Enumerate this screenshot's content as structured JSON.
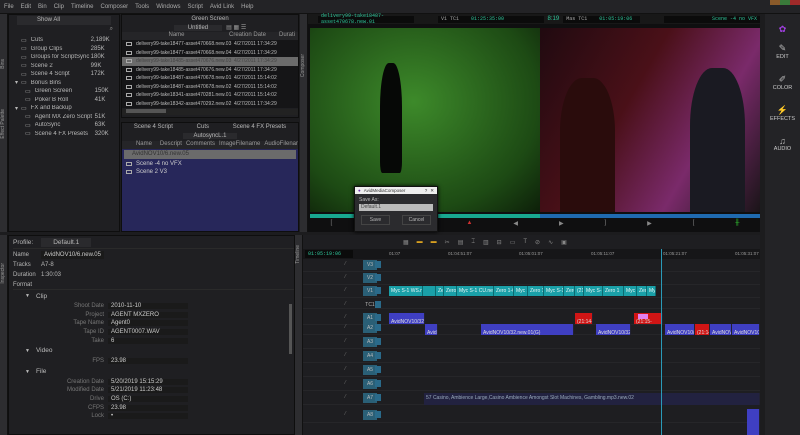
{
  "menu": [
    "File",
    "Edit",
    "Bin",
    "Clip",
    "Timeline",
    "Composer",
    "Tools",
    "Windows",
    "Script",
    "Avid Link",
    "Help"
  ],
  "bins_panel": {
    "show": "Show All",
    "tab_bins": "Bins",
    "tab_effects": "Effect Palette",
    "items": [
      {
        "name": "Cuts",
        "size": "2,189K"
      },
      {
        "name": "Group Clips",
        "size": "285K"
      },
      {
        "name": "Groups for ScriptSync",
        "size": "180K"
      },
      {
        "name": "Scene 2",
        "size": "99K"
      },
      {
        "name": "Scene 4 Script",
        "size": "172K"
      },
      {
        "name": "Bonus Bins",
        "size": ""
      },
      {
        "name": "Green Screen",
        "size": "150K"
      },
      {
        "name": "Poker B Roll",
        "size": "41K"
      },
      {
        "name": "FX and Backup",
        "size": ""
      },
      {
        "name": "Agent MX Zero Script",
        "size": "51K"
      },
      {
        "name": "AutoSync",
        "size": "63K"
      },
      {
        "name": "Scene 4 FX Presets",
        "size": "320K"
      }
    ]
  },
  "green_bin": {
    "title": "Green Screen",
    "view": "Untitled",
    "cols": [
      "Name",
      "Creation Date",
      "Durati"
    ],
    "rows": [
      [
        "delivery99-take18477-asset470668.new.03",
        "4/27/2011 17:34:29"
      ],
      [
        "delivery99-take18477-asset470668.new.04",
        "4/27/2011 17:34:29"
      ],
      [
        "delivery99-take18485-asset470676.new.03",
        "4/27/2011 17:34:29"
      ],
      [
        "delivery99-take18485-asset470676.new.04",
        "4/27/2011 17:34:29"
      ],
      [
        "delivery99-take18487-asset470678.new.01",
        "4/27/2011 15:14:02"
      ],
      [
        "delivery99-take18487-asset470678.new.02",
        "4/27/2011 15:14:02"
      ],
      [
        "delivery99-take18341-asset470281.new.01",
        "4/27/2011 15:14:02"
      ],
      [
        "delivery99-take18342-asset470292.new.02",
        "4/27/2011 17:34:29"
      ]
    ]
  },
  "script_bin": {
    "tabs": [
      "Scene 4 Script",
      "Cuts",
      "Scene 4 FX Presets"
    ],
    "view": "AutosyncL.1",
    "cols": [
      "Name",
      "Descript",
      "Comments",
      "ImageFilename",
      "AudioFilenar"
    ],
    "rows": [
      "AvidNOV10/6.new.05",
      "Scene -4 no VFX",
      "Scene 2 V3"
    ]
  },
  "composer": {
    "tab": "Composer",
    "source_clip": "delivery99-take18487-asset470678.new.01",
    "v1_label": "V1  TC1",
    "v1_tc": "01:25:35:00",
    "dur": "8:19",
    "mas_label": "Mas  TC1",
    "mas_tc": "01:05:19:06",
    "record_seq": "Scene -4 no VFX"
  },
  "right_bar": [
    {
      "label": "EDIT",
      "icon": "edit-icon"
    },
    {
      "label": "COLOR",
      "icon": "color-icon"
    },
    {
      "label": "EFFECTS",
      "icon": "effects-icon"
    },
    {
      "label": "AUDIO",
      "icon": "audio-icon"
    }
  ],
  "dialog": {
    "title": "AvidMediaComposer",
    "help": "?",
    "close": "✕",
    "label": "Save As:",
    "value": "Default.1",
    "save": "Save",
    "cancel": "Cancel"
  },
  "inspector": {
    "tab": "Inspector",
    "profile_label": "Profile:",
    "profile": "Default.1",
    "name_label": "Name",
    "name": "AvidNOV10/6.new.05",
    "tracks_label": "Tracks",
    "tracks": "A7-8",
    "duration_label": "Duration",
    "duration": "1:30:03",
    "format_label": "Format",
    "clip": {
      "title": "Clip",
      "fields": [
        [
          "Shoot Date",
          "2010-11-10"
        ],
        [
          "Project",
          "AGENT MXZERO"
        ],
        [
          "Tape Name",
          "Agent0"
        ],
        [
          "Tape ID",
          "AGENT0007.WAV"
        ],
        [
          "Take",
          "6"
        ]
      ]
    },
    "video": {
      "title": "Video",
      "fields": [
        [
          "FPS",
          "23.98"
        ]
      ]
    },
    "file": {
      "title": "File",
      "fields": [
        [
          "Creation Date",
          "5/20/2019 15:15:29"
        ],
        [
          "Modified Date",
          "5/21/2019 11:23:48"
        ],
        [
          "Drive",
          "OS (C:)"
        ],
        [
          "CFPS",
          "23.98"
        ],
        [
          "Lock",
          "•"
        ]
      ]
    }
  },
  "timeline": {
    "tab": "Timeline",
    "tc": "01:05:19:06",
    "ruler": [
      "01:07",
      "01:04:51:07",
      "01:05:01:07",
      "01:05:11:07",
      "01:05:21:07",
      "01:05:31:07"
    ],
    "tracks": [
      "V3",
      "V2",
      "V1",
      "TC1",
      "A1",
      "A2",
      "A3",
      "A4",
      "A5",
      "A6",
      "A7",
      "A8"
    ],
    "v1_clips": [
      "Myc S-1 WS.new",
      "",
      "Zero 1",
      "Zero 1",
      "Myc S-1 CU.new.01(G)",
      "Zero 1-6",
      "Myc S-1 C",
      "Zero 1-",
      "Myc S-1 CU.",
      "Zero 1-",
      "(21:15-1)",
      "Myc S-1 WS.",
      "Zero 1",
      "Myc",
      "Zero",
      "Myc"
    ],
    "a1_clips": [
      "AvidNOV10/32.z",
      "(21:14-3)",
      "(21:15-"
    ],
    "a2_clips": [
      "Avid",
      "AvidNOV10/32.new.01(G)",
      "AvidNOV10/32.",
      "AvidNOV10/",
      "(21:14-)",
      "AvidNOV",
      "AvidNOV10"
    ],
    "a6_clip": "57 Casino, Ambience Large,Casino Ambience Amongst Slot Machines, Gambling.mp3.new.02"
  }
}
